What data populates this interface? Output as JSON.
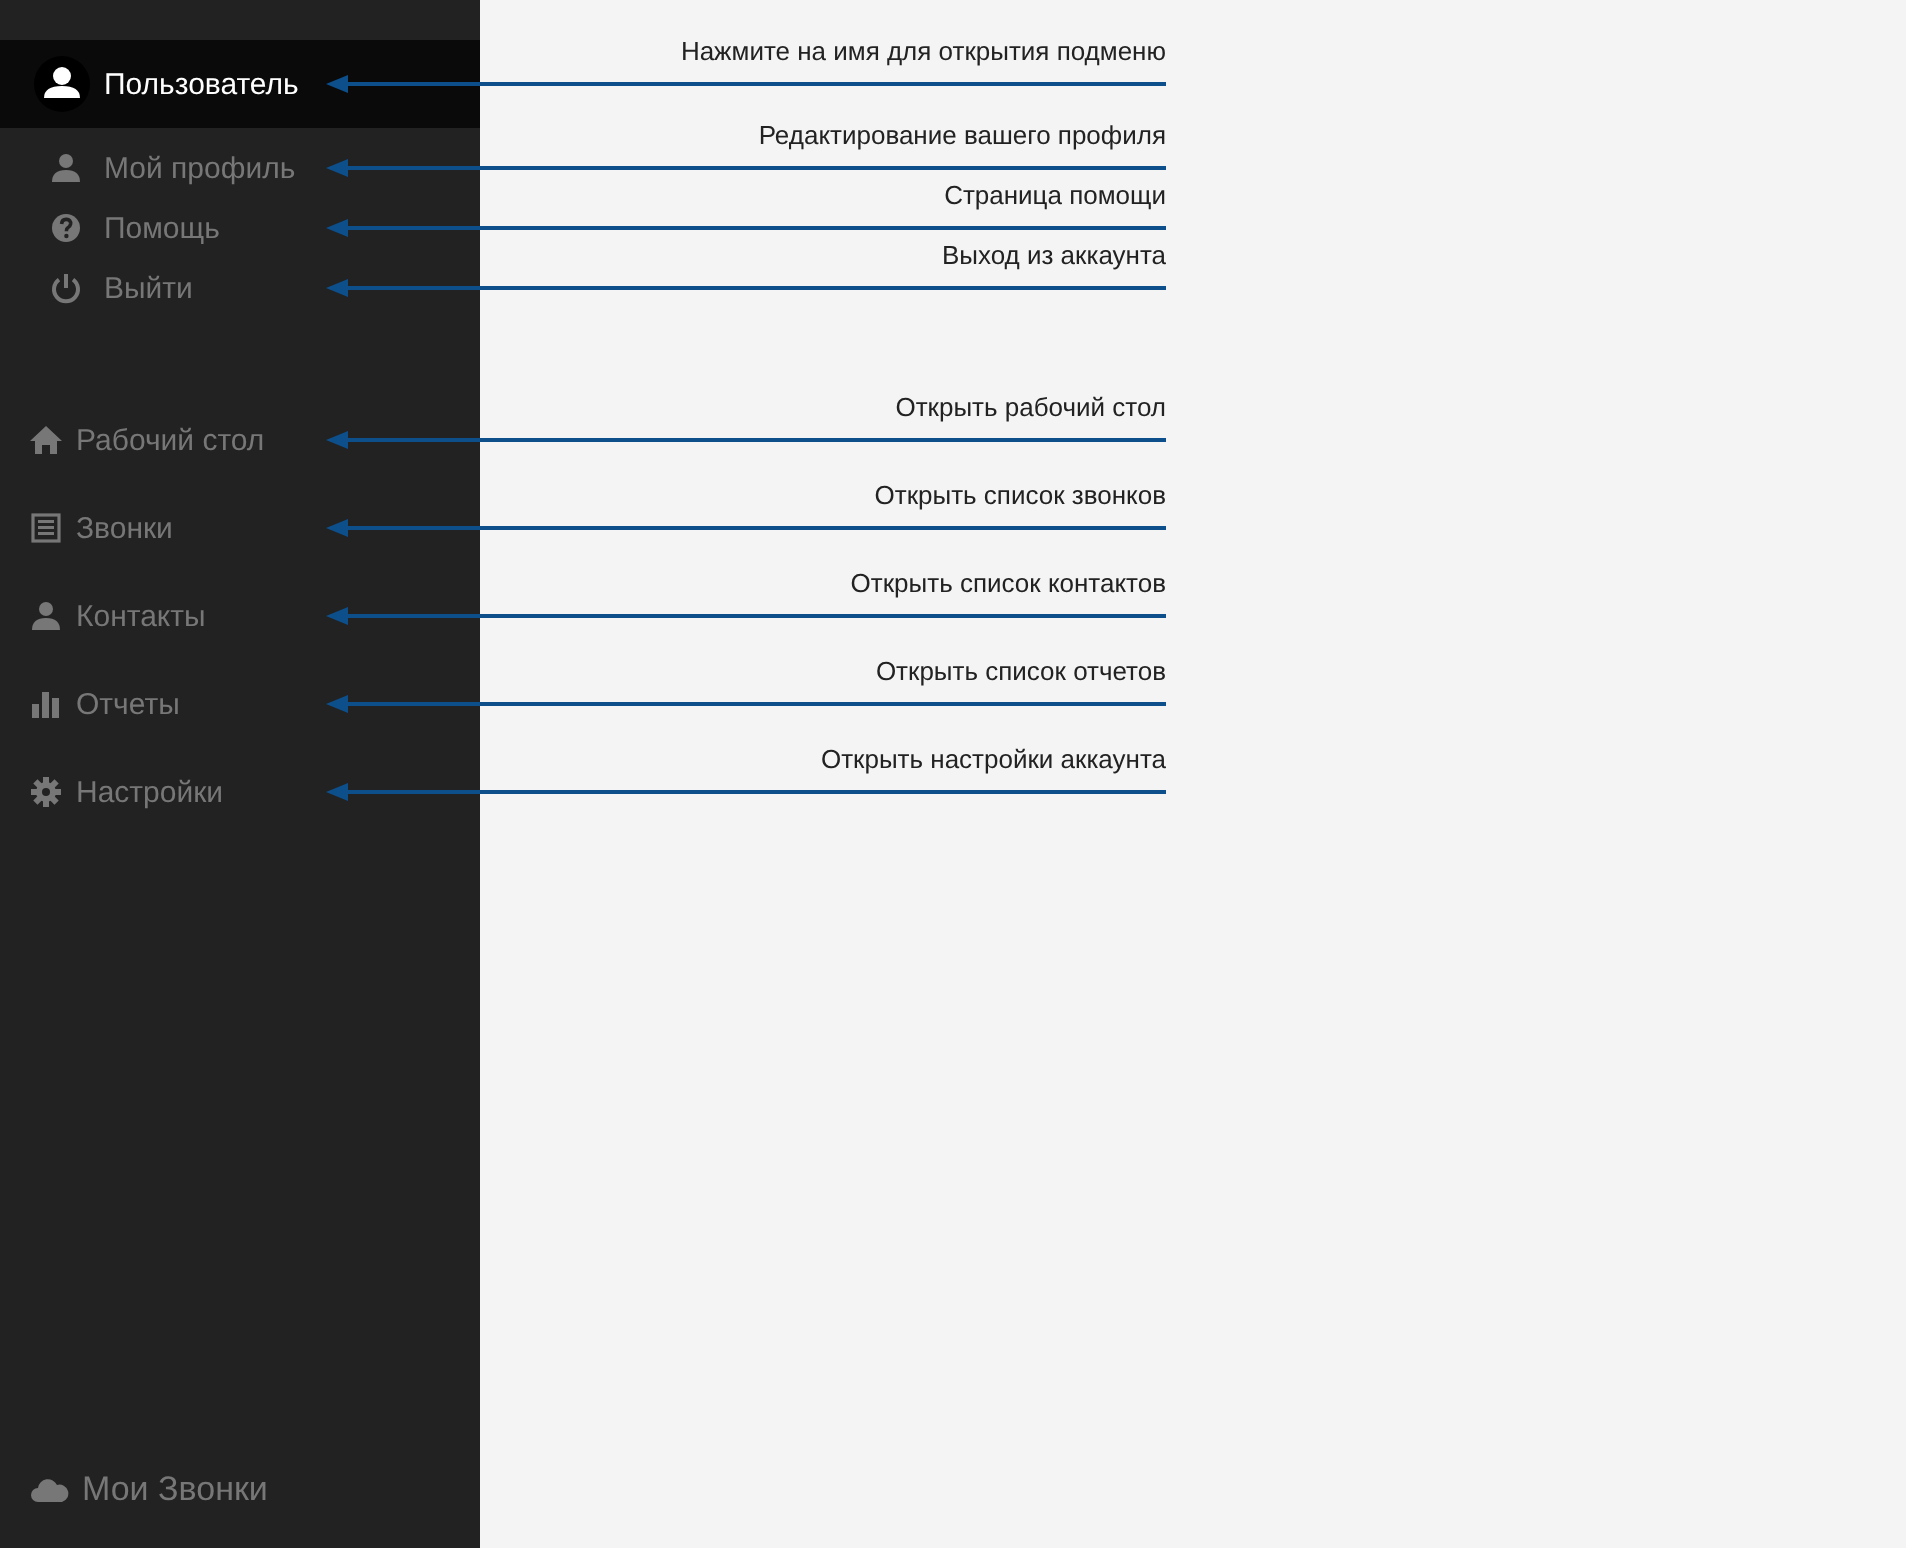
{
  "sidebar": {
    "user": {
      "label": "Пользователь",
      "selected": true,
      "note": "Нажмите на имя для открытия подменю"
    },
    "user_menu": [
      {
        "label": "Мой профиль",
        "note": "Редактирование вашего профиля"
      },
      {
        "label": "Помощь",
        "note": "Страница помощи"
      },
      {
        "label": "Выйти",
        "note": "Выход из аккаунта"
      }
    ],
    "nav": [
      {
        "label": "Рабочий стол",
        "note": "Открыть рабочий стол"
      },
      {
        "label": "Звонки",
        "note": "Открыть список звонков"
      },
      {
        "label": "Контакты",
        "note": "Открыть список контактов"
      },
      {
        "label": "Отчеты",
        "note": "Открыть список отчетов"
      },
      {
        "label": "Настройки",
        "note": "Открыть настройки аккаунта"
      }
    ],
    "footer": {
      "label": "Мои Звонки"
    }
  }
}
